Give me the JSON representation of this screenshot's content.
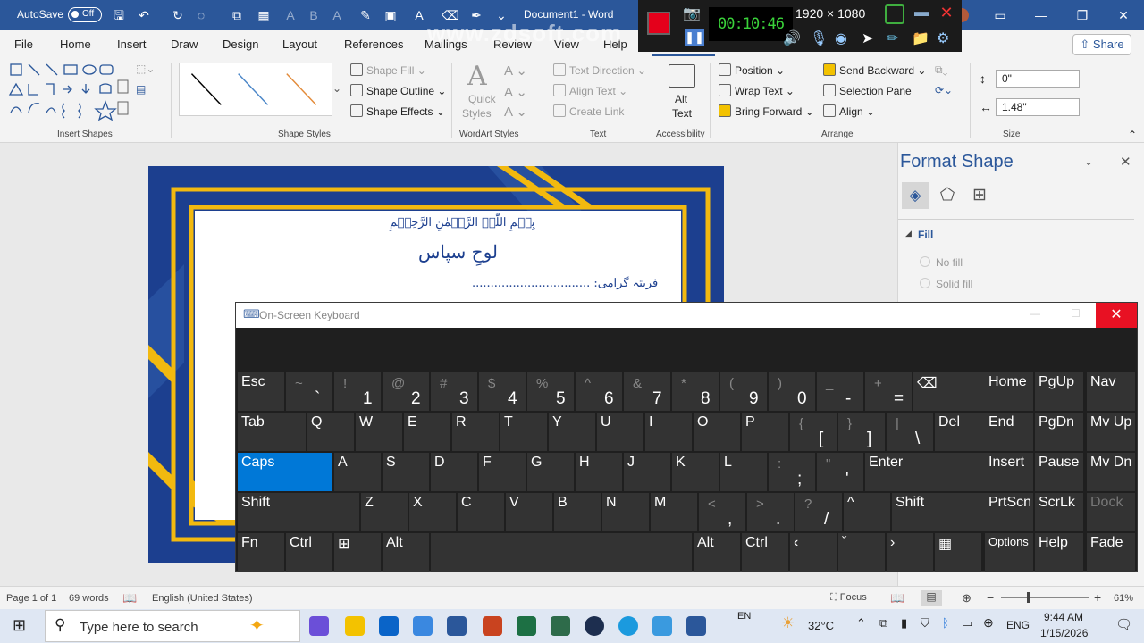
{
  "titlebar": {
    "autosave": "AutoSave",
    "toggle": "Off",
    "doc_title": "Document1 - Word"
  },
  "recorder": {
    "timer": "00:10:46",
    "resolution": "1920 × 1080",
    "watermark": "www.zdsoft.com"
  },
  "tabs": [
    "File",
    "Home",
    "Insert",
    "Draw",
    "Design",
    "Layout",
    "References",
    "Mailings",
    "Review",
    "View",
    "Help"
  ],
  "share": "Share",
  "ribbon": {
    "groups": {
      "insert_shapes": "Insert Shapes",
      "shape_styles": "Shape Styles",
      "wordart_styles": "WordArt Styles",
      "text": "Text",
      "accessibility": "Accessibility",
      "arrange": "Arrange",
      "size": "Size"
    },
    "shape_fill": "Shape Fill",
    "shape_outline": "Shape Outline",
    "shape_effects": "Shape Effects",
    "quick_styles_1": "Quick",
    "quick_styles_2": "Styles",
    "text_direction": "Text Direction",
    "align_text": "Align Text",
    "create_link": "Create Link",
    "alt_text_1": "Alt",
    "alt_text_2": "Text",
    "position": "Position",
    "wrap_text": "Wrap Text",
    "bring_forward": "Bring Forward",
    "send_backward": "Send Backward",
    "selection_pane": "Selection Pane",
    "align": "Align",
    "height": "0\"",
    "width": "1.48\""
  },
  "document": {
    "basmala": "بِسۡمِ اللّٰہِ الرَّحۡمٰنِ الرَّحِیۡمِ",
    "heading": "لوحِ سپاس",
    "field": "فریتہ گرامی: ................................"
  },
  "format_pane": {
    "title": "Format Shape",
    "fill": "Fill",
    "no_fill": "No fill",
    "solid_fill": "Solid fill"
  },
  "osk": {
    "title": "On-Screen Keyboard",
    "row1": [
      [
        "Esc",
        ""
      ],
      [
        "~",
        "`"
      ],
      [
        "!",
        "1"
      ],
      [
        "@",
        "2"
      ],
      [
        "#",
        "3"
      ],
      [
        "$",
        "4"
      ],
      [
        "%",
        "5"
      ],
      [
        "^",
        "6"
      ],
      [
        "&",
        "7"
      ],
      [
        "*",
        "8"
      ],
      [
        "(",
        "9"
      ],
      [
        ")",
        "0"
      ],
      [
        "_",
        "-"
      ],
      [
        "+",
        "="
      ],
      [
        "⌫",
        ""
      ]
    ],
    "row2": [
      [
        "Tab",
        ""
      ],
      [
        "Q",
        ""
      ],
      [
        "W",
        ""
      ],
      [
        "E",
        ""
      ],
      [
        "R",
        ""
      ],
      [
        "T",
        ""
      ],
      [
        "Y",
        ""
      ],
      [
        "U",
        ""
      ],
      [
        "I",
        ""
      ],
      [
        "O",
        ""
      ],
      [
        "P",
        ""
      ],
      [
        "{",
        "["
      ],
      [
        "}",
        "]"
      ],
      [
        "|",
        "\\"
      ],
      [
        "Del",
        ""
      ]
    ],
    "row3": [
      [
        "Caps",
        ""
      ],
      [
        "A",
        ""
      ],
      [
        "S",
        ""
      ],
      [
        "D",
        ""
      ],
      [
        "F",
        ""
      ],
      [
        "G",
        ""
      ],
      [
        "H",
        ""
      ],
      [
        "J",
        ""
      ],
      [
        "K",
        ""
      ],
      [
        "L",
        ""
      ],
      [
        ":",
        ";"
      ],
      [
        "\"",
        "'"
      ],
      [
        "Enter",
        ""
      ]
    ],
    "row4": [
      [
        "Shift",
        ""
      ],
      [
        "Z",
        ""
      ],
      [
        "X",
        ""
      ],
      [
        "C",
        ""
      ],
      [
        "V",
        ""
      ],
      [
        "B",
        ""
      ],
      [
        "N",
        ""
      ],
      [
        "M",
        ""
      ],
      [
        "<",
        ","
      ],
      [
        ">",
        "."
      ],
      [
        "?",
        "/"
      ],
      [
        "^",
        ""
      ],
      [
        "Shift",
        ""
      ]
    ],
    "row5": [
      [
        "Fn",
        ""
      ],
      [
        "Ctrl",
        ""
      ],
      [
        "⊞",
        ""
      ],
      [
        "Alt",
        ""
      ],
      [
        "",
        ""
      ],
      [
        "Alt",
        ""
      ],
      [
        "Ctrl",
        ""
      ],
      [
        "‹",
        ""
      ],
      [
        "ˇ",
        ""
      ],
      [
        "›",
        ""
      ],
      [
        "▦",
        ""
      ]
    ],
    "side": [
      [
        "Home",
        "PgUp",
        "Nav"
      ],
      [
        "End",
        "PgDn",
        "Mv Up"
      ],
      [
        "Insert",
        "Pause",
        "Mv Dn"
      ],
      [
        "PrtScn",
        "ScrLk",
        "Dock"
      ],
      [
        "Options",
        "Help",
        "Fade"
      ]
    ]
  },
  "status": {
    "page": "Page 1 of 1",
    "words": "69 words",
    "language": "English (United States)",
    "focus": "Focus",
    "zoom": "61%"
  },
  "taskbar": {
    "search_placeholder": "Type here to search",
    "lang_indicator": "EN",
    "temp": "32°C",
    "lang": "ENG",
    "time": "9:44 AM",
    "date": "1/15/2026"
  },
  "colors": {
    "word_blue": "#2b579a",
    "page_blue": "#1c3f8f",
    "frame_gold": "#f2b90f",
    "caps_active": "#0078d7",
    "close_red": "#e81123"
  }
}
